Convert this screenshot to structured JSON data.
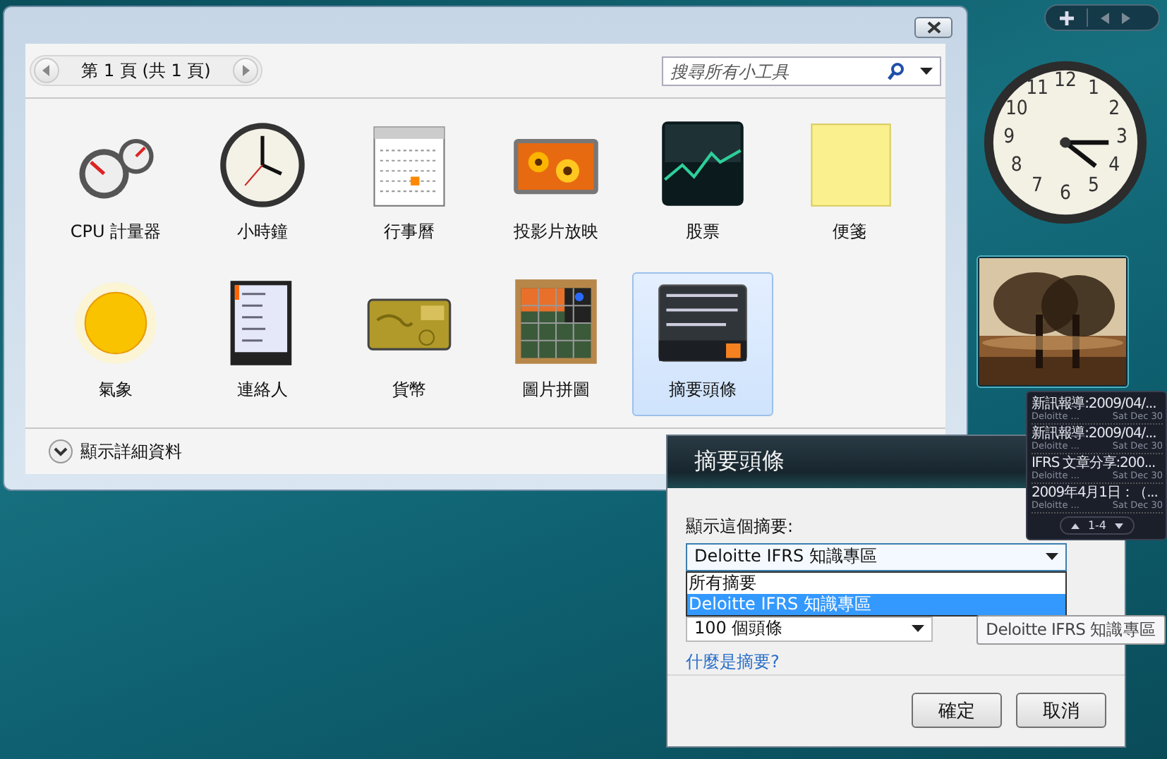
{
  "gallery": {
    "pager": {
      "label": "第 1 頁 (共 1 頁)"
    },
    "search": {
      "placeholder": "搜尋所有小工具"
    },
    "gadgets": [
      {
        "name": "CPU 計量器",
        "kind": "cpu",
        "selected": false
      },
      {
        "name": "小時鐘",
        "kind": "clock",
        "selected": false
      },
      {
        "name": "行事曆",
        "kind": "calendar",
        "selected": false
      },
      {
        "name": "投影片放映",
        "kind": "slideshow",
        "selected": false
      },
      {
        "name": "股票",
        "kind": "stocks",
        "selected": false
      },
      {
        "name": "便箋",
        "kind": "notes",
        "selected": false
      },
      {
        "name": "氣象",
        "kind": "weather",
        "selected": false
      },
      {
        "name": "連絡人",
        "kind": "contacts",
        "selected": false
      },
      {
        "name": "貨幣",
        "kind": "currency",
        "selected": false
      },
      {
        "name": "圖片拼圖",
        "kind": "puzzle",
        "selected": false
      },
      {
        "name": "摘要頭條",
        "kind": "feed",
        "selected": true
      }
    ],
    "details": "顯示詳細資料"
  },
  "sidebar": {
    "clock": {
      "numerals": [
        "11",
        "12",
        "1",
        "10",
        "2",
        "9",
        "3",
        "8",
        "4",
        "7",
        "5",
        "6"
      ]
    },
    "feed": {
      "items": [
        {
          "title": "新訊報導:2009/04/...",
          "source": "Deloitte ...",
          "date": "Sat Dec 30"
        },
        {
          "title": "新訊報導:2009/04/...",
          "source": "Deloitte ...",
          "date": "Sat Dec 30"
        },
        {
          "title": "IFRS 文章分享:200...",
          "source": "Deloitte ...",
          "date": "Sat Dec 30"
        },
        {
          "title": "2009年4月1日：（...",
          "source": "Deloitte ...",
          "date": "Sat Dec 30"
        }
      ],
      "page": "1-4"
    }
  },
  "dialog": {
    "title": "摘要頭條",
    "feed_label": "顯示這個摘要:",
    "feed_select": {
      "value": "Deloitte IFRS 知識專區",
      "expanded": true,
      "options": [
        {
          "label": "所有摘要",
          "selected": false
        },
        {
          "label": "Deloitte IFRS 知識專區",
          "selected": true
        }
      ]
    },
    "count_select": {
      "value": "100 個頭條"
    },
    "help_link": "什麼是摘要?",
    "buttons": [
      "確定",
      "取消"
    ]
  },
  "tooltip": {
    "text": "Deloitte IFRS 知識專區"
  }
}
